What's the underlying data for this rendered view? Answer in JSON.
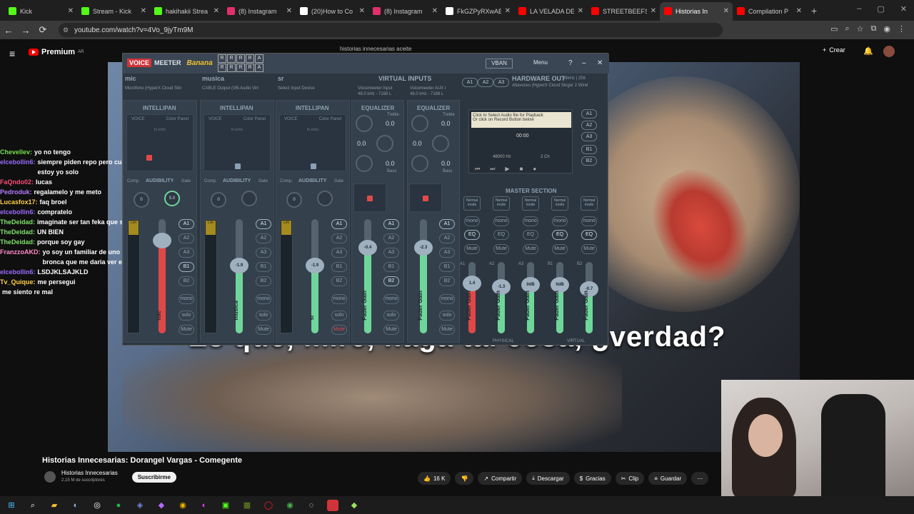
{
  "browser": {
    "tabs": [
      {
        "label": "Kick",
        "color": "#53fc18"
      },
      {
        "label": "Stream - Kick",
        "color": "#53fc18"
      },
      {
        "label": "hakihakii Strea",
        "color": "#53fc18"
      },
      {
        "label": "(8) Instagram",
        "color": "#e1306c"
      },
      {
        "label": "(20)How to Co",
        "color": "#ffffff"
      },
      {
        "label": "(8) Instagram",
        "color": "#e1306c"
      },
      {
        "label": "FkGZPyRXwAE",
        "color": "#ffffff"
      },
      {
        "label": "LA VELADA DE",
        "color": "#ff0000"
      },
      {
        "label": "STREETBEEFS",
        "color": "#ff0000"
      },
      {
        "label": "Historias In",
        "color": "#ff0000"
      },
      {
        "label": "Compilation P",
        "color": "#ff0000"
      }
    ],
    "active_tab": 9,
    "url": "youtube.com/watch?v=4Vo_9jyTm9M"
  },
  "youtube": {
    "premium_label": "Premium",
    "region": "AR",
    "search_text": "historias innecesarias aceite",
    "create_label": "Crear",
    "subtitle": "Es que, mire, haga tal cosa, ¿verdad?",
    "video_title": "Historias Innecesarias: Dorangel Vargas - Comegente",
    "channel_name": "Historias Innecesarias",
    "subscribers": "2,15 M de suscriptores",
    "subscribe_label": "Suscribirme",
    "likes": "16 K",
    "share_label": "Compartir",
    "download_label": "Descargar",
    "thanks_label": "Gracias",
    "clip_label": "Clip",
    "save_label": "Guardar"
  },
  "chat": [
    {
      "user": "Chevellev:",
      "text": "yo no tengo",
      "color": "#76e04a"
    },
    {
      "user": "elcebollin6:",
      "text": "siempre piden repo pero cuando hay que estar estoy yo solo",
      "color": "#9b6bff"
    },
    {
      "user": "FaQndo02:",
      "text": "lucas",
      "color": "#ff4a7a"
    },
    {
      "user": "Pedroduk:",
      "text": "regalamelo y me meto",
      "color": "#b47cff"
    },
    {
      "user": "Lucasfox17:",
      "text": "faq broel",
      "color": "#ffce48"
    },
    {
      "user": "elcebollin6:",
      "text": "compratelo",
      "color": "#9b6bff"
    },
    {
      "user": "TheDeidad:",
      "text": "imaginate ser tan feka que solo cebollin está",
      "color": "#7fe06a"
    },
    {
      "user": "TheDeidad:",
      "text": "UN BIEN",
      "color": "#7fe06a"
    },
    {
      "user": "TheDeidad:",
      "text": "porque soy gay",
      "color": "#7fe06a"
    },
    {
      "user": "FranzzoAKD:",
      "text": "yo soy un familiar de uno que se comio, y la bronca que me daria ver eso",
      "color": "#ff8ac7"
    },
    {
      "user": "elcebollin6:",
      "text": "LSDJKLSAJKLD",
      "color": "#9b6bff"
    },
    {
      "user": "Tv_Quique:",
      "text": "me persegui",
      "color": "#ffce48"
    },
    {
      "user": "",
      "text": "me siento re mal",
      "color": "#ffffff"
    }
  ],
  "voicemeeter": {
    "brand1": "VOICE",
    "brand2": "MEETER",
    "edition": "Banana",
    "vban": "VBAN",
    "menu": "Menu",
    "inputs": [
      {
        "name": "mic",
        "device": "Micrófono (HyperX Cloud Stin"
      },
      {
        "name": "musica",
        "device": "CABLE Output (VB-Audio Virt"
      },
      {
        "name": "sr",
        "device": "Select Input Device"
      }
    ],
    "virtual_inputs_label": "VIRTUAL INPUTS",
    "virtual_inputs": [
      {
        "name": "Voicemeeter Input",
        "info": "48.0 kHz - 7168 L"
      },
      {
        "name": "Voicemeeter AUX I",
        "info": "48.0 kHz - 7168 L"
      }
    ],
    "hardware_out_label": "HARDWARE OUT",
    "hardware_out_info": "48kHz | 256",
    "hardware_out_device": "Altavoces (HyperX Cloud Singer 2 Wirel",
    "intellipan": "INTELLIPAN",
    "equalizer": "EQUALIZER",
    "voice": "VOICE",
    "color_panel": "Color Panel",
    "fx_echo": "fx echo",
    "audibility": "AUDIBILITY",
    "comp": "Comp.",
    "gate": "Gate",
    "treble": "Treble",
    "bass": "Bass",
    "eq_zero": "0.0",
    "strip_gains": [
      "",
      "-1.9",
      "-1.9",
      "-0.4",
      "-2.3"
    ],
    "fader_names": [
      "mic",
      "musica",
      "sr",
      "Fader Gain",
      "Fader Gain"
    ],
    "tape_msg1": "Click to Select Audio file for Playback",
    "tape_msg2": "Or click on Record Button below",
    "tape_time": "00:00",
    "tape_rate": "48000 Hz",
    "tape_ch": "2 Ch",
    "master_label": "MASTER SECTION",
    "master_gains": [
      "1.4",
      "-1.3",
      "0dB",
      "0dB",
      "-0.7"
    ],
    "master_names": [
      "Fader Gain",
      "Fader Gain",
      "Fader Gain",
      "Fader Gain",
      "Fader Gain"
    ],
    "physical": "PHYSICAL",
    "virtual": "VIRTUAL",
    "comp_val": "0",
    "gate_val": "5.0",
    "mute_label": "Mute",
    "solo_label": "solo",
    "mono_label": "mono"
  }
}
